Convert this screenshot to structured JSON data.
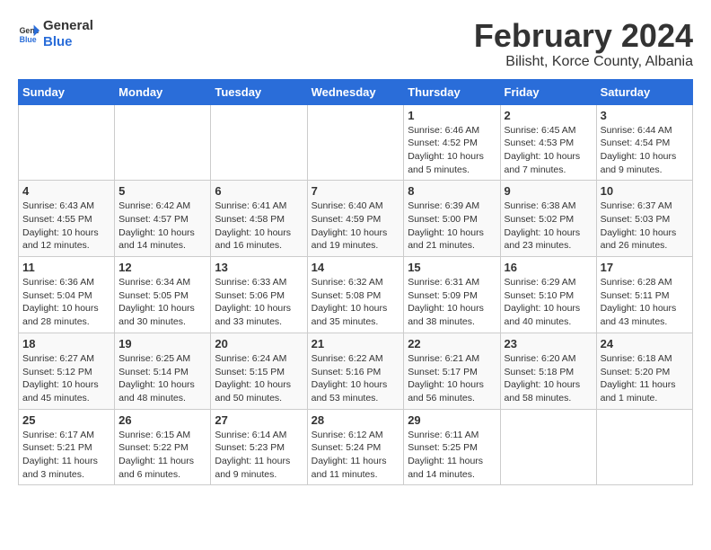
{
  "logo": {
    "general": "General",
    "blue": "Blue"
  },
  "title": "February 2024",
  "subtitle": "Bilisht, Korce County, Albania",
  "days_of_week": [
    "Sunday",
    "Monday",
    "Tuesday",
    "Wednesday",
    "Thursday",
    "Friday",
    "Saturday"
  ],
  "weeks": [
    [
      {
        "day": "",
        "info": ""
      },
      {
        "day": "",
        "info": ""
      },
      {
        "day": "",
        "info": ""
      },
      {
        "day": "",
        "info": ""
      },
      {
        "day": "1",
        "info": "Sunrise: 6:46 AM\nSunset: 4:52 PM\nDaylight: 10 hours and 5 minutes."
      },
      {
        "day": "2",
        "info": "Sunrise: 6:45 AM\nSunset: 4:53 PM\nDaylight: 10 hours and 7 minutes."
      },
      {
        "day": "3",
        "info": "Sunrise: 6:44 AM\nSunset: 4:54 PM\nDaylight: 10 hours and 9 minutes."
      }
    ],
    [
      {
        "day": "4",
        "info": "Sunrise: 6:43 AM\nSunset: 4:55 PM\nDaylight: 10 hours and 12 minutes."
      },
      {
        "day": "5",
        "info": "Sunrise: 6:42 AM\nSunset: 4:57 PM\nDaylight: 10 hours and 14 minutes."
      },
      {
        "day": "6",
        "info": "Sunrise: 6:41 AM\nSunset: 4:58 PM\nDaylight: 10 hours and 16 minutes."
      },
      {
        "day": "7",
        "info": "Sunrise: 6:40 AM\nSunset: 4:59 PM\nDaylight: 10 hours and 19 minutes."
      },
      {
        "day": "8",
        "info": "Sunrise: 6:39 AM\nSunset: 5:00 PM\nDaylight: 10 hours and 21 minutes."
      },
      {
        "day": "9",
        "info": "Sunrise: 6:38 AM\nSunset: 5:02 PM\nDaylight: 10 hours and 23 minutes."
      },
      {
        "day": "10",
        "info": "Sunrise: 6:37 AM\nSunset: 5:03 PM\nDaylight: 10 hours and 26 minutes."
      }
    ],
    [
      {
        "day": "11",
        "info": "Sunrise: 6:36 AM\nSunset: 5:04 PM\nDaylight: 10 hours and 28 minutes."
      },
      {
        "day": "12",
        "info": "Sunrise: 6:34 AM\nSunset: 5:05 PM\nDaylight: 10 hours and 30 minutes."
      },
      {
        "day": "13",
        "info": "Sunrise: 6:33 AM\nSunset: 5:06 PM\nDaylight: 10 hours and 33 minutes."
      },
      {
        "day": "14",
        "info": "Sunrise: 6:32 AM\nSunset: 5:08 PM\nDaylight: 10 hours and 35 minutes."
      },
      {
        "day": "15",
        "info": "Sunrise: 6:31 AM\nSunset: 5:09 PM\nDaylight: 10 hours and 38 minutes."
      },
      {
        "day": "16",
        "info": "Sunrise: 6:29 AM\nSunset: 5:10 PM\nDaylight: 10 hours and 40 minutes."
      },
      {
        "day": "17",
        "info": "Sunrise: 6:28 AM\nSunset: 5:11 PM\nDaylight: 10 hours and 43 minutes."
      }
    ],
    [
      {
        "day": "18",
        "info": "Sunrise: 6:27 AM\nSunset: 5:12 PM\nDaylight: 10 hours and 45 minutes."
      },
      {
        "day": "19",
        "info": "Sunrise: 6:25 AM\nSunset: 5:14 PM\nDaylight: 10 hours and 48 minutes."
      },
      {
        "day": "20",
        "info": "Sunrise: 6:24 AM\nSunset: 5:15 PM\nDaylight: 10 hours and 50 minutes."
      },
      {
        "day": "21",
        "info": "Sunrise: 6:22 AM\nSunset: 5:16 PM\nDaylight: 10 hours and 53 minutes."
      },
      {
        "day": "22",
        "info": "Sunrise: 6:21 AM\nSunset: 5:17 PM\nDaylight: 10 hours and 56 minutes."
      },
      {
        "day": "23",
        "info": "Sunrise: 6:20 AM\nSunset: 5:18 PM\nDaylight: 10 hours and 58 minutes."
      },
      {
        "day": "24",
        "info": "Sunrise: 6:18 AM\nSunset: 5:20 PM\nDaylight: 11 hours and 1 minute."
      }
    ],
    [
      {
        "day": "25",
        "info": "Sunrise: 6:17 AM\nSunset: 5:21 PM\nDaylight: 11 hours and 3 minutes."
      },
      {
        "day": "26",
        "info": "Sunrise: 6:15 AM\nSunset: 5:22 PM\nDaylight: 11 hours and 6 minutes."
      },
      {
        "day": "27",
        "info": "Sunrise: 6:14 AM\nSunset: 5:23 PM\nDaylight: 11 hours and 9 minutes."
      },
      {
        "day": "28",
        "info": "Sunrise: 6:12 AM\nSunset: 5:24 PM\nDaylight: 11 hours and 11 minutes."
      },
      {
        "day": "29",
        "info": "Sunrise: 6:11 AM\nSunset: 5:25 PM\nDaylight: 11 hours and 14 minutes."
      },
      {
        "day": "",
        "info": ""
      },
      {
        "day": "",
        "info": ""
      }
    ]
  ]
}
